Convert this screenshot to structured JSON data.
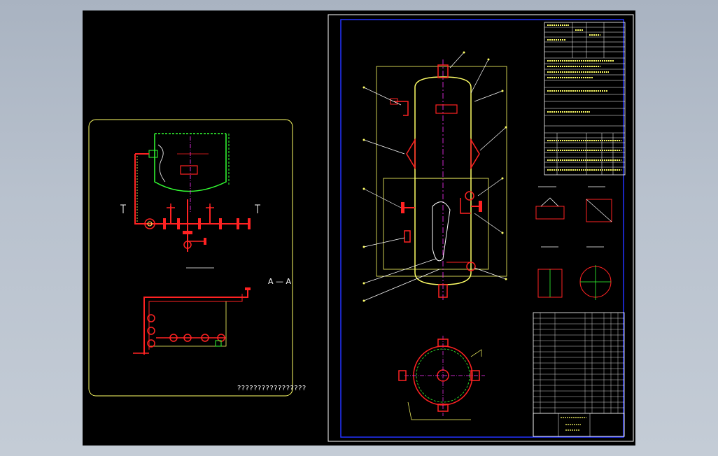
{
  "drawing": {
    "section_label": "A — A",
    "caption": "?????????????????",
    "colors": {
      "background": "#000000",
      "frame_yellow": "#ffff66",
      "vessel_green": "#33ff33",
      "pipe_red": "#ff2222",
      "border_blue": "#2233ff",
      "magenta": "#ff33ff",
      "dim_white": "#ffffff"
    }
  }
}
